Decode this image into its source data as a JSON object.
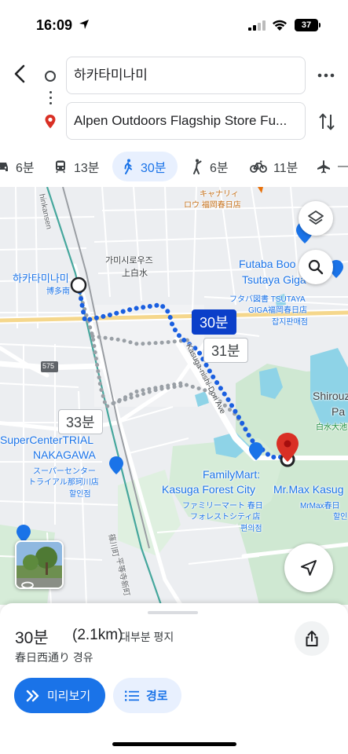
{
  "status_bar": {
    "time": "16:09",
    "battery": "37"
  },
  "search": {
    "origin": "하카타미나미",
    "destination": "Alpen Outdoors Flagship Store Fu..."
  },
  "modes": [
    {
      "icon": "car-icon",
      "label": "6분"
    },
    {
      "icon": "transit-icon",
      "label": "13분"
    },
    {
      "icon": "walk-icon",
      "label": "30분",
      "active": true
    },
    {
      "icon": "rideshare-icon",
      "label": "6분"
    },
    {
      "icon": "bicycle-icon",
      "label": "11분"
    },
    {
      "icon": "flight-icon",
      "label": "—"
    }
  ],
  "map": {
    "labels": {
      "shinkansen": "hinkansen",
      "kamishiro_kana": "가미시로우즈",
      "kamishiro_kanji": "上白水",
      "hakata_minami": "하카타미나미",
      "hakata_minami_jp": "博多南",
      "futaba_1": "Futaba Boo",
      "futaba_2": "Tsutaya Giga",
      "futaba_jp_1": "フタバ図書 TSUTAYA",
      "futaba_jp_2": "GIGA福岡春日店",
      "futaba_kr": "잡지판매점",
      "street": "Kasuga-nishi-Dori Ave",
      "shirouzu": "Shirouzu",
      "shirouzu_pa": "Pa",
      "shirouzu_jp": "白水大池",
      "supercenter_1": "SuperCenterTRIAL",
      "supercenter_2": "NAKAGAWA",
      "supercenter_jp_1": "スーパーセンター",
      "supercenter_jp_2": "トライアル那珂川店",
      "supercenter_kr": "할인점",
      "familymart_1": "FamilyMart:",
      "familymart_2": "Kasuga Forest City",
      "familymart_jp_1": "ファミリーマート 春日",
      "familymart_jp_2": "フォレストシティ店",
      "familymart_kr": "편의점",
      "mrmax": "Mr.Max Kasug",
      "mrmax_jp": "MrMax春日",
      "mrmax_kr": "할인",
      "top_shop_1": "キャナリィ",
      "top_shop_2": "ロウ 福岡春日店",
      "road_number": "575",
      "railway_jp": "平等寺新町",
      "railway_jp2": "篠川町"
    },
    "badges": {
      "selected": "30분",
      "alt_1": "31분",
      "alt_2": "33분"
    }
  },
  "summary": {
    "time": "30분",
    "distance": "(2.1km)",
    "terrain": "대부분 평지",
    "via": "春日西通り 경유"
  },
  "actions": {
    "preview": "미리보기",
    "steps": "경로"
  },
  "colors": {
    "accent": "#1a73e8",
    "route_selected": "#1a5fe0",
    "route_alt": "#9aa0a6",
    "destination_pin": "#d93025"
  }
}
